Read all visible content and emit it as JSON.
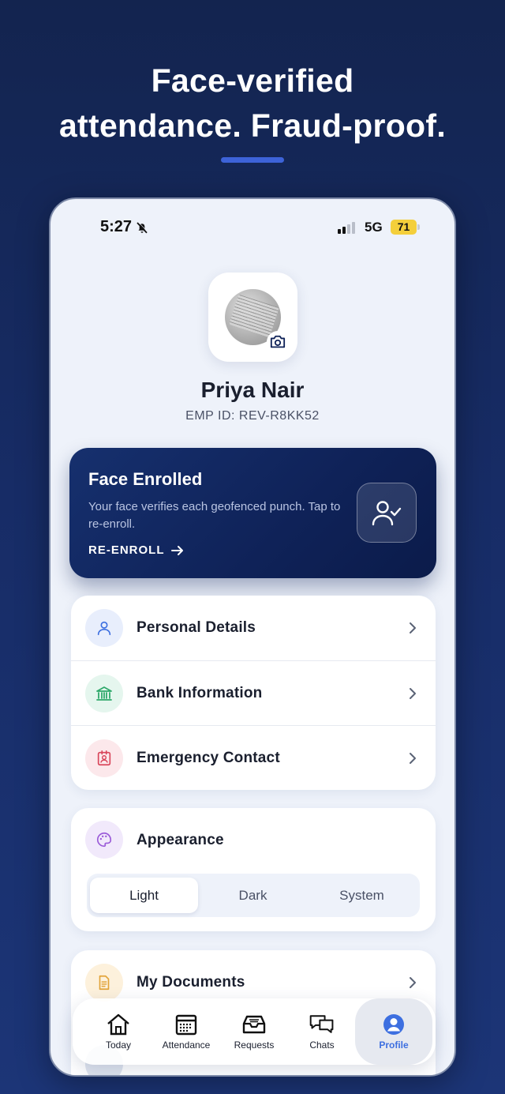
{
  "headline": {
    "line1": "Face-verified",
    "line2": "attendance. Fraud-proof."
  },
  "status_bar": {
    "time": "5:27",
    "network": "5G",
    "battery": "71"
  },
  "profile": {
    "name": "Priya Nair",
    "emp_id": "EMP ID: REV-R8KK52"
  },
  "face_card": {
    "title": "Face Enrolled",
    "description": "Your face verifies each geofenced punch. Tap to re-enroll.",
    "action": "RE-ENROLL"
  },
  "menu": {
    "items": [
      {
        "label": "Personal Details",
        "icon": "person-icon",
        "color": "#3d6fe0",
        "bg": "#e8eefc"
      },
      {
        "label": "Bank Information",
        "icon": "bank-icon",
        "color": "#2fa96b",
        "bg": "#e5f6ee"
      },
      {
        "label": "Emergency Contact",
        "icon": "contact-card-icon",
        "color": "#d9455a",
        "bg": "#fce8eb"
      }
    ]
  },
  "appearance": {
    "label": "Appearance",
    "options": [
      "Light",
      "Dark",
      "System"
    ],
    "selected": "Light"
  },
  "documents": {
    "label": "My Documents"
  },
  "tabs": [
    {
      "label": "Today",
      "icon": "home-icon"
    },
    {
      "label": "Attendance",
      "icon": "calendar-icon"
    },
    {
      "label": "Requests",
      "icon": "inbox-icon"
    },
    {
      "label": "Chats",
      "icon": "chat-icon"
    },
    {
      "label": "Profile",
      "icon": "profile-icon",
      "active": true
    }
  ],
  "colors": {
    "accent": "#3d6fe0",
    "card_navy": "#0f2258",
    "headline_bar": "#3d63d8"
  }
}
